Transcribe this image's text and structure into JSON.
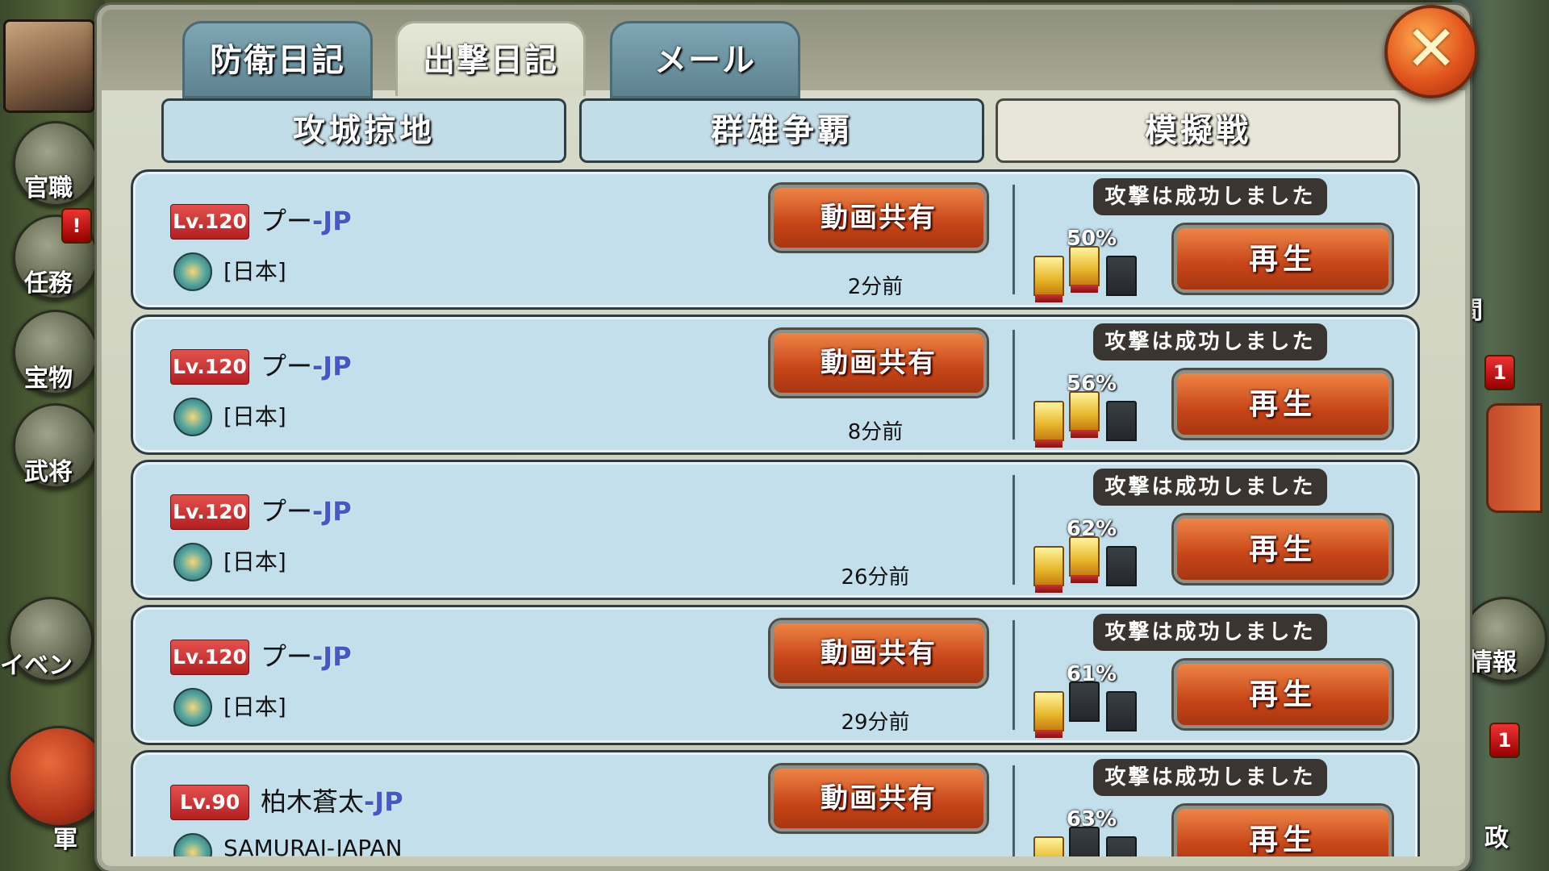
{
  "tabs": [
    {
      "label": "防衛日記",
      "active": false
    },
    {
      "label": "出撃日記",
      "active": true
    },
    {
      "label": "メール",
      "active": false
    }
  ],
  "subtabs": [
    {
      "label": "攻城掠地",
      "active": false
    },
    {
      "label": "群雄争覇",
      "active": false
    },
    {
      "label": "模擬戦",
      "active": true
    }
  ],
  "side_left": {
    "labels": [
      "官職",
      "任務",
      "宝物",
      "武将",
      "イベン",
      "軍"
    ]
  },
  "side_right": {
    "labels": [
      "間",
      "情報",
      "政"
    ],
    "badges": [
      "1",
      "1"
    ]
  },
  "alert_badge": "!",
  "close_icon": "close-x-icon",
  "share_label": "動画共有",
  "play_label": "再生",
  "rows": [
    {
      "level": "Lv.120",
      "name": "プー",
      "suffix": "-JP",
      "server": "[日本]",
      "time": "2分前",
      "result": "攻撃は成功しました",
      "percent": "50%",
      "banners": [
        "gold",
        "gold",
        "dark"
      ],
      "share": true
    },
    {
      "level": "Lv.120",
      "name": "プー",
      "suffix": "-JP",
      "server": "[日本]",
      "time": "8分前",
      "result": "攻撃は成功しました",
      "percent": "56%",
      "banners": [
        "gold",
        "gold",
        "dark"
      ],
      "share": true
    },
    {
      "level": "Lv.120",
      "name": "プー",
      "suffix": "-JP",
      "server": "[日本]",
      "time": "26分前",
      "result": "攻撃は成功しました",
      "percent": "62%",
      "banners": [
        "gold",
        "gold",
        "dark"
      ],
      "share": false
    },
    {
      "level": "Lv.120",
      "name": "プー",
      "suffix": "-JP",
      "server": "[日本]",
      "time": "29分前",
      "result": "攻撃は成功しました",
      "percent": "61%",
      "banners": [
        "gold",
        "dark",
        "dark"
      ],
      "share": true
    },
    {
      "level": "Lv.90",
      "name": "柏木蒼太",
      "suffix": "-JP",
      "server": "SAMURAI-JAPAN",
      "time": "",
      "result": "攻撃は成功しました",
      "percent": "63%",
      "banners": [
        "gold",
        "dark",
        "dark"
      ],
      "share": true
    }
  ]
}
